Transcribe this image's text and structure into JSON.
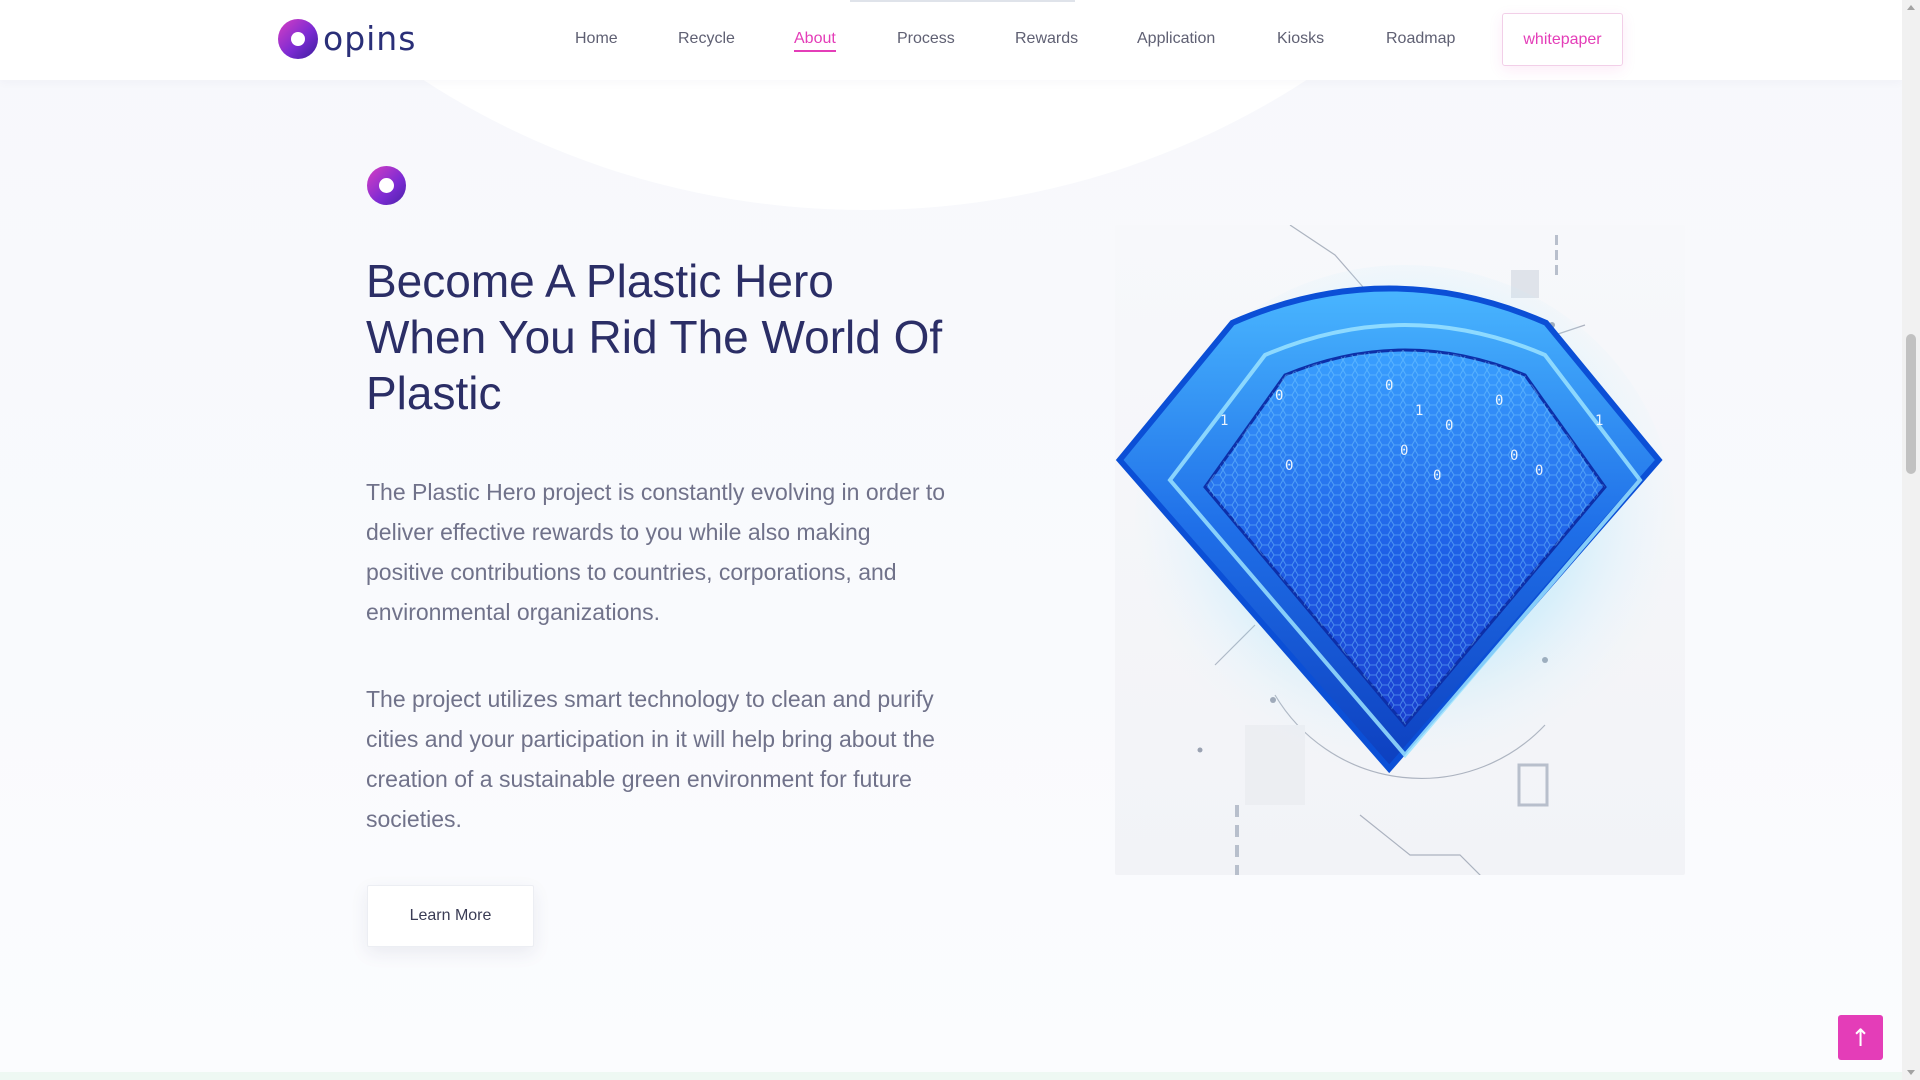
{
  "brand": {
    "name": "opins"
  },
  "nav": {
    "items": [
      {
        "label": "Home",
        "active": false
      },
      {
        "label": "Recycle",
        "active": false
      },
      {
        "label": "About",
        "active": true
      },
      {
        "label": "Process",
        "active": false
      },
      {
        "label": "Rewards",
        "active": false
      },
      {
        "label": "Application",
        "active": false
      },
      {
        "label": "Kiosks",
        "active": false
      },
      {
        "label": "Roadmap",
        "active": false
      }
    ],
    "cta_label": "whitepaper"
  },
  "about": {
    "badge_icon": "opins-ring-icon",
    "headline": "Become A Plastic Hero When You Rid The World Of Plastic",
    "paragraph_1": "The Plastic Hero project is constantly evolving in order to deliver effective rewards to you while also making positive contributions to countries, corporations, and environmental organizations.",
    "paragraph_2": "The project utilizes smart technology to clean and purify cities and your participation in it will help bring about the creation of a sustainable green environment for future societies.",
    "button_label": "Learn More",
    "illustration": "blue-diamond-shield-icon"
  },
  "back_to_top": {
    "icon": "arrow-up-icon",
    "glyph": "↑"
  },
  "colors": {
    "accent": "#e43db8",
    "heading": "#2b2e66",
    "body_text": "#70728a",
    "shield_blue": "#1f6fe8"
  }
}
